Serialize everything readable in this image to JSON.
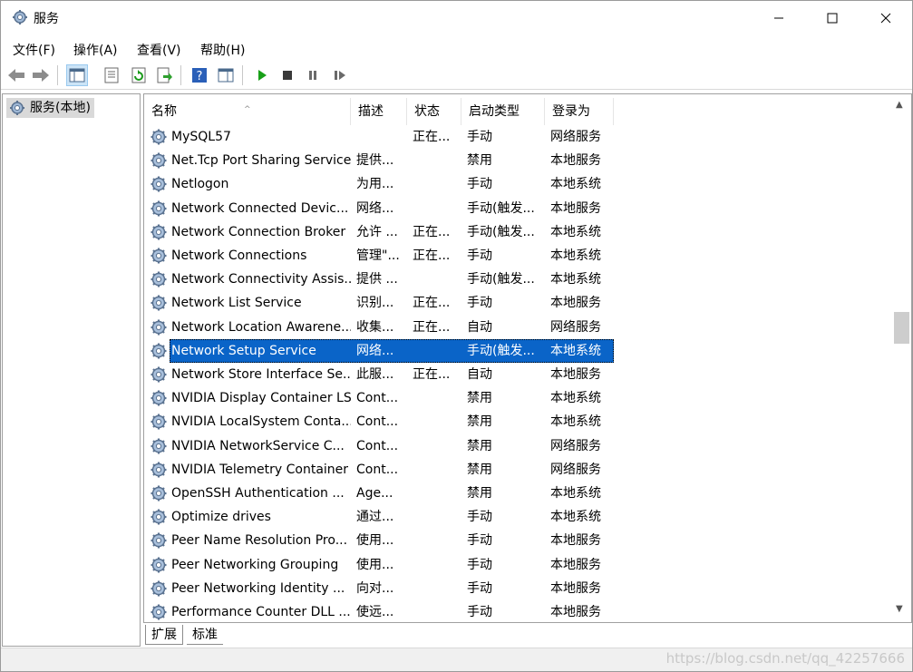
{
  "window": {
    "title": "服务"
  },
  "menu": [
    "文件(F)",
    "操作(A)",
    "查看(V)",
    "帮助(H)"
  ],
  "tree": {
    "root_label": "服务(本地)"
  },
  "columns": [
    "名称",
    "描述",
    "状态",
    "启动类型",
    "登录为"
  ],
  "rows": [
    {
      "name": "MySQL57",
      "desc": "",
      "status": "正在...",
      "startup": "手动",
      "logon": "网络服务"
    },
    {
      "name": "Net.Tcp Port Sharing Service",
      "desc": "提供...",
      "status": "",
      "startup": "禁用",
      "logon": "本地服务"
    },
    {
      "name": "Netlogon",
      "desc": "为用...",
      "status": "",
      "startup": "手动",
      "logon": "本地系统"
    },
    {
      "name": "Network Connected Devic...",
      "desc": "网络...",
      "status": "",
      "startup": "手动(触发...",
      "logon": "本地服务"
    },
    {
      "name": "Network Connection Broker",
      "desc": "允许 ...",
      "status": "正在...",
      "startup": "手动(触发...",
      "logon": "本地系统"
    },
    {
      "name": "Network Connections",
      "desc": "管理\"...",
      "status": "正在...",
      "startup": "手动",
      "logon": "本地系统"
    },
    {
      "name": "Network Connectivity Assis...",
      "desc": "提供 ...",
      "status": "",
      "startup": "手动(触发...",
      "logon": "本地系统"
    },
    {
      "name": "Network List Service",
      "desc": "识别...",
      "status": "正在...",
      "startup": "手动",
      "logon": "本地服务"
    },
    {
      "name": "Network Location Awarene...",
      "desc": "收集...",
      "status": "正在...",
      "startup": "自动",
      "logon": "网络服务"
    },
    {
      "name": "Network Setup Service",
      "desc": "网络...",
      "status": "",
      "startup": "手动(触发...",
      "logon": "本地系统"
    },
    {
      "name": "Network Store Interface Se...",
      "desc": "此服...",
      "status": "正在...",
      "startup": "自动",
      "logon": "本地服务"
    },
    {
      "name": "NVIDIA Display Container LS",
      "desc": "Cont...",
      "status": "",
      "startup": "禁用",
      "logon": "本地系统"
    },
    {
      "name": "NVIDIA LocalSystem Conta...",
      "desc": "Cont...",
      "status": "",
      "startup": "禁用",
      "logon": "本地系统"
    },
    {
      "name": "NVIDIA NetworkService C...",
      "desc": "Cont...",
      "status": "",
      "startup": "禁用",
      "logon": "网络服务"
    },
    {
      "name": "NVIDIA Telemetry Container",
      "desc": "Cont...",
      "status": "",
      "startup": "禁用",
      "logon": "网络服务"
    },
    {
      "name": "OpenSSH Authentication ...",
      "desc": "Age...",
      "status": "",
      "startup": "禁用",
      "logon": "本地系统"
    },
    {
      "name": "Optimize drives",
      "desc": "通过...",
      "status": "",
      "startup": "手动",
      "logon": "本地系统"
    },
    {
      "name": "Peer Name Resolution Pro...",
      "desc": "使用...",
      "status": "",
      "startup": "手动",
      "logon": "本地服务"
    },
    {
      "name": "Peer Networking Grouping",
      "desc": "使用...",
      "status": "",
      "startup": "手动",
      "logon": "本地服务"
    },
    {
      "name": "Peer Networking Identity ...",
      "desc": "向对...",
      "status": "",
      "startup": "手动",
      "logon": "本地服务"
    },
    {
      "name": "Performance Counter DLL ...",
      "desc": "使远...",
      "status": "",
      "startup": "手动",
      "logon": "本地服务"
    }
  ],
  "selected_index": 9,
  "tabs": [
    "扩展",
    "标准"
  ],
  "watermark": "https://blog.csdn.net/qq_42257666",
  "colors": {
    "selection": "#0a64c8",
    "play_icon": "#18a018"
  }
}
